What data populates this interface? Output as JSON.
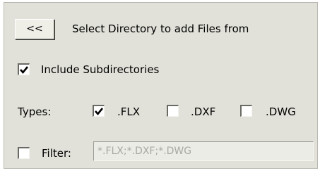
{
  "header": {
    "back_button_label": "<<",
    "title": "Select Directory to add Files from"
  },
  "include_subdirectories": {
    "label": "Include Subdirectories",
    "checked": true
  },
  "types": {
    "label": "Types:",
    "options": [
      {
        "label": ".FLX",
        "checked": true
      },
      {
        "label": ".DXF",
        "checked": false
      },
      {
        "label": ".DWG",
        "checked": false
      }
    ]
  },
  "filter": {
    "label": "Filter:",
    "checked": false,
    "value": "*.FLX;*.DXF;*.DWG"
  },
  "colors": {
    "panel_bg": "#e1e1d9",
    "input_disabled_text": "#a9a9a3"
  }
}
